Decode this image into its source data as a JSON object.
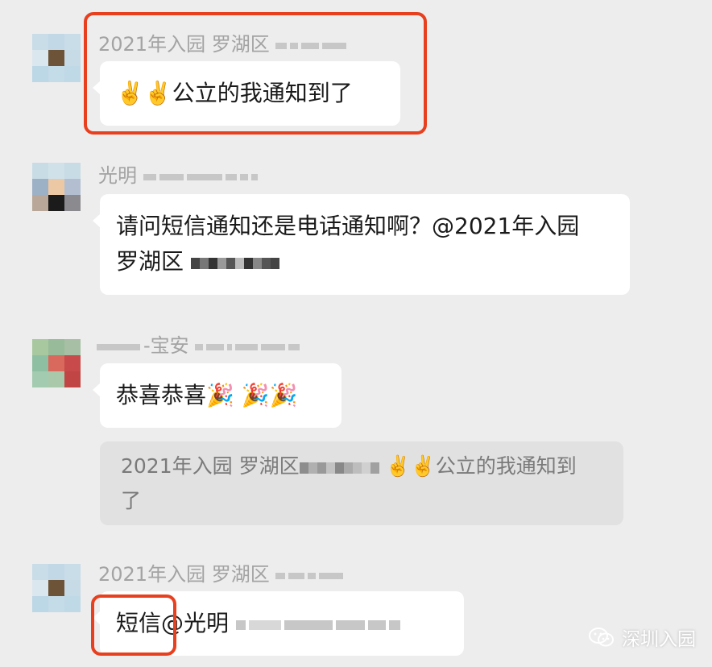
{
  "messages": [
    {
      "sender": "2021年入园 罗湖区",
      "text": "✌️✌️公立的我通知到了"
    },
    {
      "sender": "光明",
      "text_line1": "请问短信通知还是电话通知啊？@2021年入园",
      "text_line2": "罗湖区"
    },
    {
      "sender": "-宝安",
      "text": "恭喜恭喜🎉 🎉🎉",
      "quote_line1": "2021年入园 罗湖区",
      "quote_line1_tail": "✌️✌️公立的我通知到",
      "quote_line2": "了"
    },
    {
      "sender": "2021年入园 罗湖区",
      "text": "短信@光明"
    }
  ],
  "watermark": {
    "text": "深圳入园",
    "icon": "wechat-icon"
  },
  "colors": {
    "background": "#ededed",
    "bubble": "#ffffff",
    "quote": "#e1e1e1",
    "highlight": "#e8401f",
    "sender_name": "#a3a3a3"
  }
}
